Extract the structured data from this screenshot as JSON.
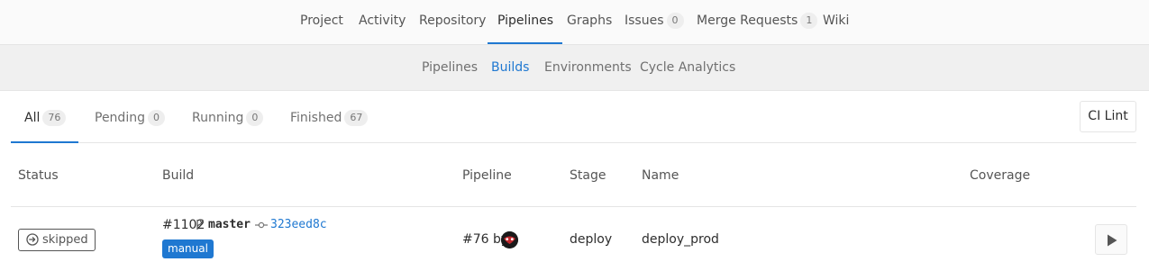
{
  "topnav": {
    "items": [
      {
        "label": "Project"
      },
      {
        "label": "Activity"
      },
      {
        "label": "Repository"
      },
      {
        "label": "Pipelines",
        "active": true
      },
      {
        "label": "Graphs"
      },
      {
        "label": "Issues",
        "count": "0"
      },
      {
        "label": "Merge Requests",
        "count": "1"
      },
      {
        "label": "Wiki"
      }
    ]
  },
  "subnav": {
    "items": [
      {
        "label": "Pipelines"
      },
      {
        "label": "Builds",
        "active": true
      },
      {
        "label": "Environments"
      },
      {
        "label": "Cycle Analytics"
      }
    ]
  },
  "scopes": {
    "tabs": [
      {
        "label": "All",
        "count": "76",
        "active": true
      },
      {
        "label": "Pending",
        "count": "0"
      },
      {
        "label": "Running",
        "count": "0"
      },
      {
        "label": "Finished",
        "count": "67"
      }
    ],
    "ci_lint_label": "CI Lint"
  },
  "table": {
    "headers": {
      "status": "Status",
      "build": "Build",
      "pipeline": "Pipeline",
      "stage": "Stage",
      "name": "Name",
      "coverage": "Coverage"
    },
    "rows": [
      {
        "status": "skipped",
        "build_id": "#1102",
        "ref": "master",
        "sha": "323eed8c",
        "tag": "manual",
        "pipeline": "#76",
        "pipeline_by": "by",
        "stage": "deploy",
        "name": "deploy_prod"
      }
    ]
  },
  "colors": {
    "accent": "#1f78d1",
    "text": "#2e2e2e",
    "muted": "#707070",
    "border": "#e5e5e5"
  },
  "icons": [
    "status-skipped-icon",
    "branch-icon",
    "commit-icon",
    "play-icon",
    "user-avatar"
  ]
}
